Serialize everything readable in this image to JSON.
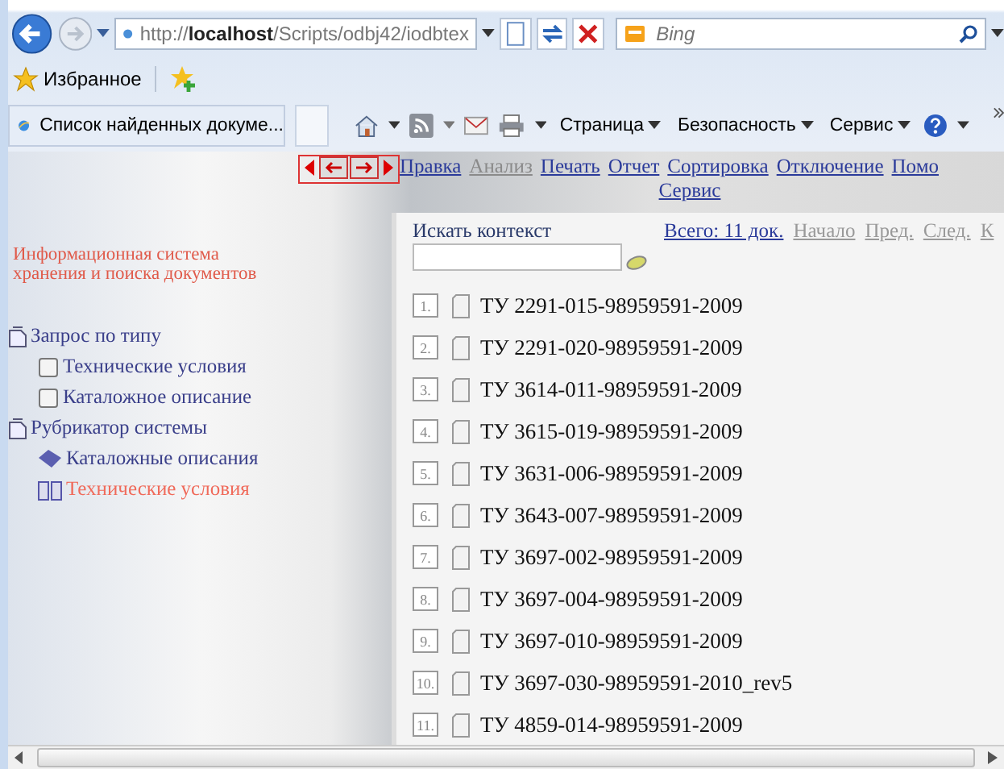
{
  "browser": {
    "address": "http://**localhost**/Scripts/odbj42/iodbtex",
    "search_placeholder": "Bing",
    "favorites": "Избранное",
    "tab": "Список найденных докуме...",
    "commands": [
      "Страница",
      "Безопасность",
      "Сервис"
    ]
  },
  "nav_links": [
    {
      "label": "Правка",
      "disabled": false
    },
    {
      "label": "Анализ",
      "disabled": true
    },
    {
      "label": "Печать",
      "disabled": false
    },
    {
      "label": "Отчет",
      "disabled": false
    },
    {
      "label": "Сортировка",
      "disabled": false
    },
    {
      "label": "Отключение",
      "disabled": false
    },
    {
      "label": "Помо",
      "disabled": false
    },
    {
      "label": "Сервис",
      "disabled": false
    }
  ],
  "sidebar": {
    "title": "Информационная система хранения и поиска документов",
    "tree": [
      {
        "label": "Запрос по типу",
        "kind": "folder",
        "selected": false,
        "children": [
          {
            "label": "Технические условия",
            "kind": "page",
            "selected": false
          },
          {
            "label": "Каталожное описание",
            "kind": "page",
            "selected": false
          }
        ]
      },
      {
        "label": "Рубрикатор системы",
        "kind": "folder",
        "selected": false,
        "children": [
          {
            "label": "Каталожные описания",
            "kind": "book",
            "selected": false
          },
          {
            "label": "Технические условия",
            "kind": "open-book",
            "selected": true
          }
        ]
      }
    ]
  },
  "search": {
    "label": "Искать контекст",
    "total": "Всего: 11 док.",
    "pager": [
      {
        "label": "Начало",
        "disabled": true
      },
      {
        "label": "Пред.",
        "disabled": true
      },
      {
        "label": "След.",
        "disabled": true
      },
      {
        "label": "К",
        "disabled": true
      }
    ]
  },
  "results": [
    {
      "number": "1.",
      "title": "ТУ 2291-015-98959591-2009"
    },
    {
      "number": "2.",
      "title": "ТУ 2291-020-98959591-2009"
    },
    {
      "number": "3.",
      "title": "ТУ 3614-011-98959591-2009"
    },
    {
      "number": "4.",
      "title": "ТУ 3615-019-98959591-2009"
    },
    {
      "number": "5.",
      "title": "ТУ 3631-006-98959591-2009"
    },
    {
      "number": "6.",
      "title": "ТУ 3643-007-98959591-2009"
    },
    {
      "number": "7.",
      "title": "ТУ 3697-002-98959591-2009"
    },
    {
      "number": "8.",
      "title": "ТУ 3697-004-98959591-2009"
    },
    {
      "number": "9.",
      "title": "ТУ 3697-010-98959591-2009"
    },
    {
      "number": "10.",
      "title": "ТУ 3697-030-98959591-2010_rev5"
    },
    {
      "number": "11.",
      "title": "ТУ 4859-014-98959591-2009"
    }
  ]
}
